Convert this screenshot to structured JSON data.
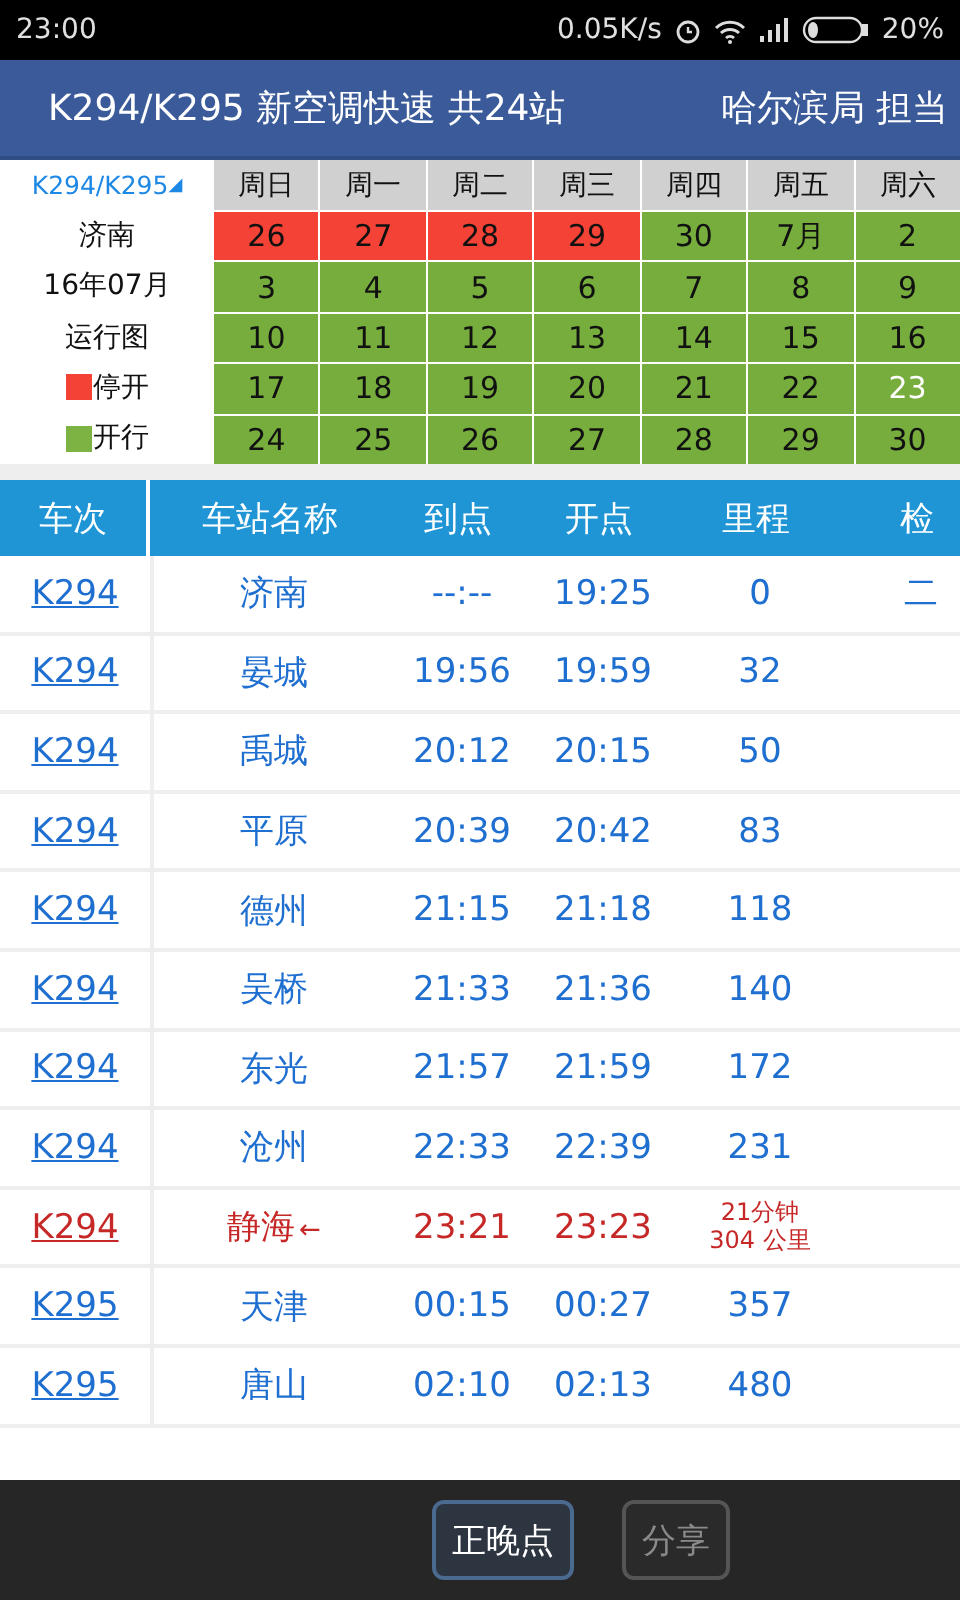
{
  "status_bar": {
    "time": "23:00",
    "speed": "0.05K/s",
    "battery": "20%"
  },
  "title_bar": {
    "train": "K294/K295 新空调快速 共24站",
    "bureau": "哈尔滨局 担当"
  },
  "calendar": {
    "train_link": "K294/K295",
    "dropdown_mark": "◢",
    "station": "济南",
    "month": "16年07月",
    "caption": "运行图",
    "legend": [
      {
        "label": "停开",
        "color": "#f44336"
      },
      {
        "label": "开行",
        "color": "#7cb342"
      }
    ],
    "weekdays": [
      "周日",
      "周一",
      "周二",
      "周三",
      "周四",
      "周五",
      "周六"
    ],
    "weeks": [
      [
        {
          "day": "26",
          "running": false,
          "today": false
        },
        {
          "day": "27",
          "running": false,
          "today": false
        },
        {
          "day": "28",
          "running": false,
          "today": false
        },
        {
          "day": "29",
          "running": false,
          "today": false
        },
        {
          "day": "30",
          "running": true,
          "today": false
        },
        {
          "day": "7月",
          "running": true,
          "today": false
        },
        {
          "day": "2",
          "running": true,
          "today": false
        }
      ],
      [
        {
          "day": "3",
          "running": true,
          "today": false
        },
        {
          "day": "4",
          "running": true,
          "today": false
        },
        {
          "day": "5",
          "running": true,
          "today": false
        },
        {
          "day": "6",
          "running": true,
          "today": false
        },
        {
          "day": "7",
          "running": true,
          "today": false
        },
        {
          "day": "8",
          "running": true,
          "today": false
        },
        {
          "day": "9",
          "running": true,
          "today": false
        }
      ],
      [
        {
          "day": "10",
          "running": true,
          "today": false
        },
        {
          "day": "11",
          "running": true,
          "today": false
        },
        {
          "day": "12",
          "running": true,
          "today": false
        },
        {
          "day": "13",
          "running": true,
          "today": false
        },
        {
          "day": "14",
          "running": true,
          "today": false
        },
        {
          "day": "15",
          "running": true,
          "today": false
        },
        {
          "day": "16",
          "running": true,
          "today": false
        }
      ],
      [
        {
          "day": "17",
          "running": true,
          "today": false
        },
        {
          "day": "18",
          "running": true,
          "today": false
        },
        {
          "day": "19",
          "running": true,
          "today": false
        },
        {
          "day": "20",
          "running": true,
          "today": false
        },
        {
          "day": "21",
          "running": true,
          "today": false
        },
        {
          "day": "22",
          "running": true,
          "today": false
        },
        {
          "day": "23",
          "running": true,
          "today": true
        }
      ],
      [
        {
          "day": "24",
          "running": true,
          "today": false
        },
        {
          "day": "25",
          "running": true,
          "today": false
        },
        {
          "day": "26",
          "running": true,
          "today": false
        },
        {
          "day": "27",
          "running": true,
          "today": false
        },
        {
          "day": "28",
          "running": true,
          "today": false
        },
        {
          "day": "29",
          "running": true,
          "today": false
        },
        {
          "day": "30",
          "running": true,
          "today": false
        }
      ]
    ]
  },
  "table": {
    "columns": [
      "车次",
      "车站名称",
      "到点",
      "开点",
      "里程",
      "检"
    ],
    "rows": [
      {
        "train": "K294",
        "station": "济南",
        "arrive": "--:--",
        "depart": "19:25",
        "mileage": [
          "0"
        ],
        "gate": "二",
        "current": false
      },
      {
        "train": "K294",
        "station": "晏城",
        "arrive": "19:56",
        "depart": "19:59",
        "mileage": [
          "32"
        ],
        "current": false
      },
      {
        "train": "K294",
        "station": "禹城",
        "arrive": "20:12",
        "depart": "20:15",
        "mileage": [
          "50"
        ],
        "current": false
      },
      {
        "train": "K294",
        "station": "平原",
        "arrive": "20:39",
        "depart": "20:42",
        "mileage": [
          "83"
        ],
        "current": false
      },
      {
        "train": "K294",
        "station": "德州",
        "arrive": "21:15",
        "depart": "21:18",
        "mileage": [
          "118"
        ],
        "current": false
      },
      {
        "train": "K294",
        "station": "吴桥",
        "arrive": "21:33",
        "depart": "21:36",
        "mileage": [
          "140"
        ],
        "current": false
      },
      {
        "train": "K294",
        "station": "东光",
        "arrive": "21:57",
        "depart": "21:59",
        "mileage": [
          "172"
        ],
        "current": false
      },
      {
        "train": "K294",
        "station": "沧州",
        "arrive": "22:33",
        "depart": "22:39",
        "mileage": [
          "231"
        ],
        "current": false
      },
      {
        "train": "K294",
        "station": "静海",
        "marker": "←",
        "arrive": "23:21",
        "depart": "23:23",
        "mileage": [
          "21分钟",
          "304 公里"
        ],
        "current": true
      },
      {
        "train": "K295",
        "station": "天津",
        "arrive": "00:15",
        "depart": "00:27",
        "mileage": [
          "357"
        ],
        "current": false
      },
      {
        "train": "K295",
        "station": "唐山",
        "arrive": "02:10",
        "depart": "02:13",
        "mileage": [
          "480"
        ],
        "current": false
      }
    ]
  },
  "bottom_bar": {
    "buttons": [
      "正晚点",
      "分享"
    ]
  }
}
